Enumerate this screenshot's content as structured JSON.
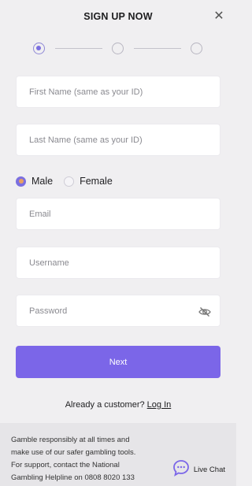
{
  "header": {
    "title": "SIGN UP NOW",
    "close_icon": "close-icon"
  },
  "stepper": {
    "steps": [
      "step-1",
      "step-2",
      "step-3"
    ],
    "current_step": 1
  },
  "form": {
    "first_name": {
      "placeholder": "First Name (same as your ID)",
      "value": ""
    },
    "last_name": {
      "placeholder": "Last Name (same as your ID)",
      "value": ""
    },
    "gender": {
      "options": [
        "Male",
        "Female"
      ],
      "selected": "Male"
    },
    "email": {
      "placeholder": "Email",
      "value": ""
    },
    "username": {
      "placeholder": "Username",
      "value": ""
    },
    "password": {
      "placeholder": "Password",
      "value": "",
      "toggle_icon": "eye-off-icon"
    },
    "next_label": "Next"
  },
  "login": {
    "prompt": "Already a customer?",
    "link_label": "Log In"
  },
  "footer": {
    "line1": "Gamble responsibly at all times and",
    "line2": "make use of our safer gambling tools.",
    "line3": "For support, contact the National",
    "line4": "Gambling Helpline on 0808 8020 133",
    "live_chat_label": "Live Chat",
    "live_chat_icon": "chat-bubble-icon"
  },
  "colors": {
    "accent": "#7b66e8",
    "radio_dot": "#e8a062",
    "background": "#f0eff1",
    "footer_bg": "#e6e5e8"
  }
}
